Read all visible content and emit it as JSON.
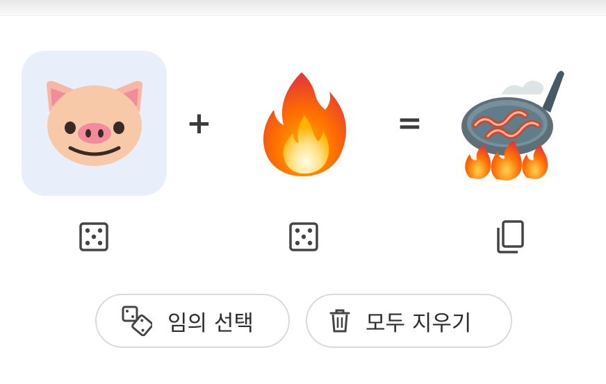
{
  "equation": {
    "left": {
      "emoji_name": "pig-face",
      "selected": true
    },
    "operator_plus": "+",
    "middle": {
      "emoji_name": "fire"
    },
    "operator_equals": "=",
    "result": {
      "emoji_name": "bacon-frying-on-fire"
    }
  },
  "controls": {
    "left_random_icon": "dice-icon",
    "middle_random_icon": "dice-icon",
    "result_copy_icon": "copy-icon"
  },
  "actions": {
    "random_label": "임의 선택",
    "random_icon": "shuffle-dice-icon",
    "clear_label": "모두 지우기",
    "clear_icon": "trash-icon"
  },
  "colors": {
    "selected_slot_bg": "#e8effb",
    "pill_border": "#d9d9d9",
    "icon_gray": "#444444"
  }
}
